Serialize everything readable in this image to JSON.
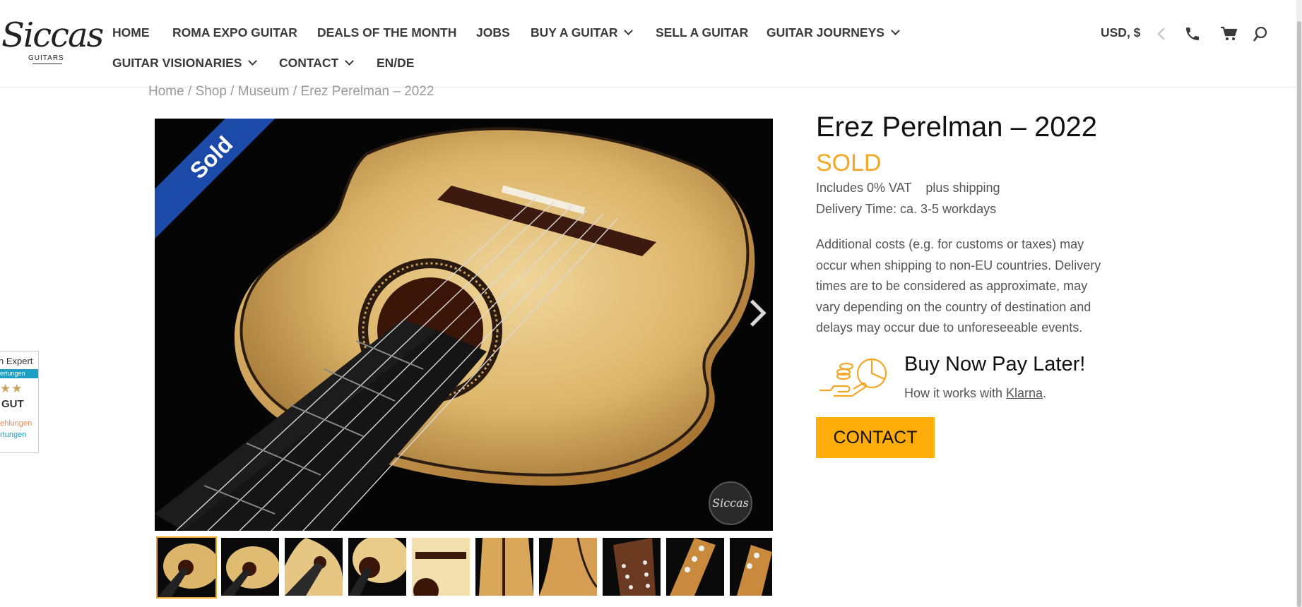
{
  "logo": {
    "script": "Siccas",
    "sub": "GUITARS"
  },
  "nav": {
    "row1": [
      {
        "label": "HOME",
        "dropdown": false
      },
      {
        "label": "ROMA EXPO GUITAR",
        "dropdown": false
      },
      {
        "label": "DEALS OF THE MONTH",
        "dropdown": false
      },
      {
        "label": "JOBS",
        "dropdown": false
      },
      {
        "label": "BUY A GUITAR",
        "dropdown": true
      },
      {
        "label": "SELL A GUITAR",
        "dropdown": false
      },
      {
        "label": "GUITAR JOURNEYS",
        "dropdown": true
      }
    ],
    "row2": [
      {
        "label": "GUITAR VISIONARIES",
        "dropdown": true
      },
      {
        "label": "CONTACT",
        "dropdown": true
      },
      {
        "label": "EN/DE",
        "dropdown": false
      }
    ]
  },
  "header_right": {
    "currency": "USD, $"
  },
  "breadcrumb": {
    "home": "Home",
    "shop": "Shop",
    "museum": "Museum",
    "current": "Erez Perelman – 2022",
    "sep": " / "
  },
  "gallery": {
    "badge": "Sold",
    "watermark": "Siccas",
    "thumb_count": 10
  },
  "product": {
    "title": "Erez Perelman – 2022",
    "status": "SOLD",
    "vat": "Includes 0% VAT",
    "shipping": "plus shipping",
    "delivery": "Delivery Time: ca. 3-5 workdays",
    "additional": "Additional costs (e.g. for customs or taxes) may occur when shipping to non-EU countries. Delivery times are to be considered as approximate, may vary depending on the country of destination and delays may occur due to unforeseeable events."
  },
  "bnpl": {
    "title": "Buy Now Pay Later!",
    "sub_prefix": "How it works with ",
    "link": "Klarna",
    "sub_suffix": "."
  },
  "cta": {
    "contact": "CONTACT"
  },
  "trust_widget": {
    "t1": "n Expert",
    "t2": "ertungen",
    "stars": "★★",
    "grade": "GUT",
    "t3": "ehlungen",
    "t4": "rtungen"
  },
  "colors": {
    "accent": "#f5a623",
    "button": "#ffad0a",
    "ribbon": "#1b4aa8"
  }
}
